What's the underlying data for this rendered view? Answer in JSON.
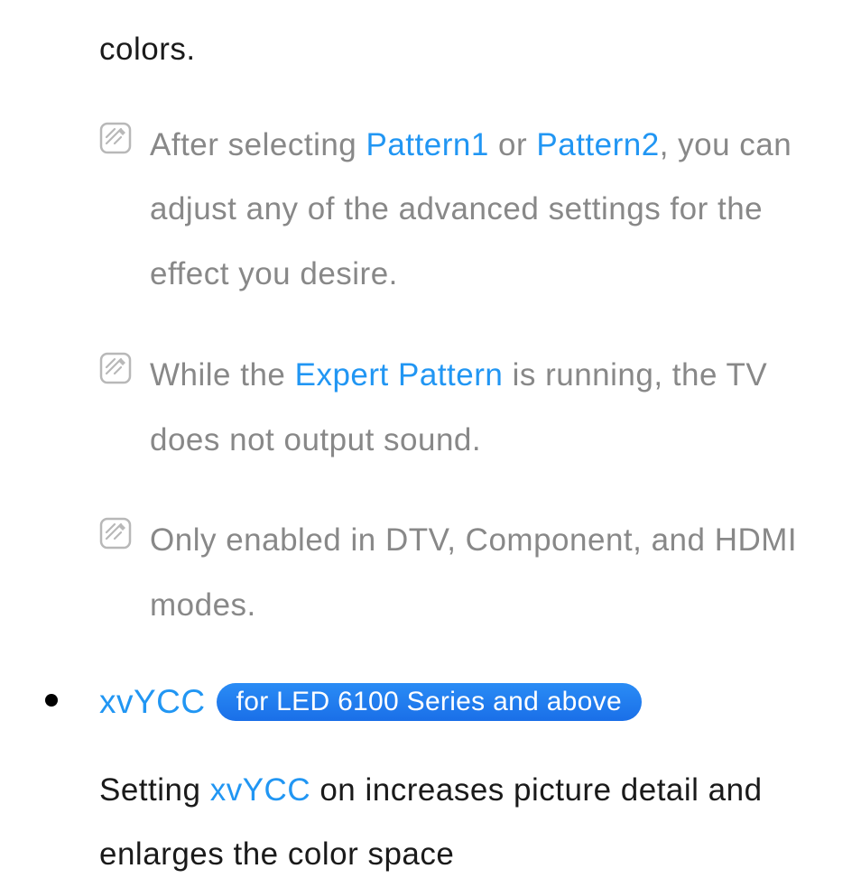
{
  "fragment_top": "colors.",
  "notes": [
    {
      "pre1": "After selecting ",
      "hl1": "Pattern1",
      "mid": " or ",
      "hl2": "Pattern2",
      "post": ", you can adjust any of the advanced settings for the effect you desire."
    },
    {
      "pre1": "While the ",
      "hl1": "Expert Pattern",
      "post": " is running, the TV does not output sound."
    },
    {
      "post": "Only enabled in DTV, Component, and HDMI modes."
    }
  ],
  "section": {
    "title": "xvYCC",
    "pill": "for LED 6100 Series and above",
    "body_pre": "Setting ",
    "body_hl": "xvYCC",
    "body_post": " on increases picture detail and enlarges the color space"
  }
}
